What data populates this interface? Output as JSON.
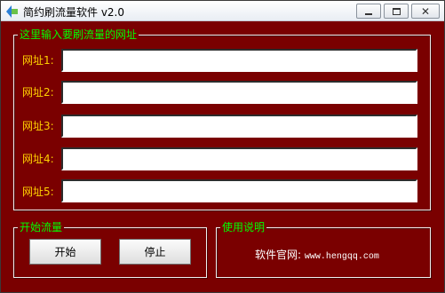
{
  "window": {
    "title": "简约刷流量软件 v2.0",
    "controls": {
      "minimize": "minimize",
      "maximize": "maximize",
      "close": "✕"
    }
  },
  "url_group": {
    "legend": "这里输入要刷流量的网址",
    "fields": [
      {
        "label": "网址1:",
        "value": ""
      },
      {
        "label": "网址2:",
        "value": ""
      },
      {
        "label": "网址3:",
        "value": ""
      },
      {
        "label": "网址4:",
        "value": ""
      },
      {
        "label": "网址5:",
        "value": ""
      }
    ]
  },
  "start_group": {
    "legend": "开始流量",
    "start_label": "开始",
    "stop_label": "停止"
  },
  "help_group": {
    "legend": "使用说明",
    "site_label": "软件官网:",
    "site_url": "www.hengqq.com"
  },
  "colors": {
    "background": "#7a0000",
    "legend_text": "#00ff00",
    "label_text": "#ffd000",
    "help_text": "#ffffff"
  }
}
